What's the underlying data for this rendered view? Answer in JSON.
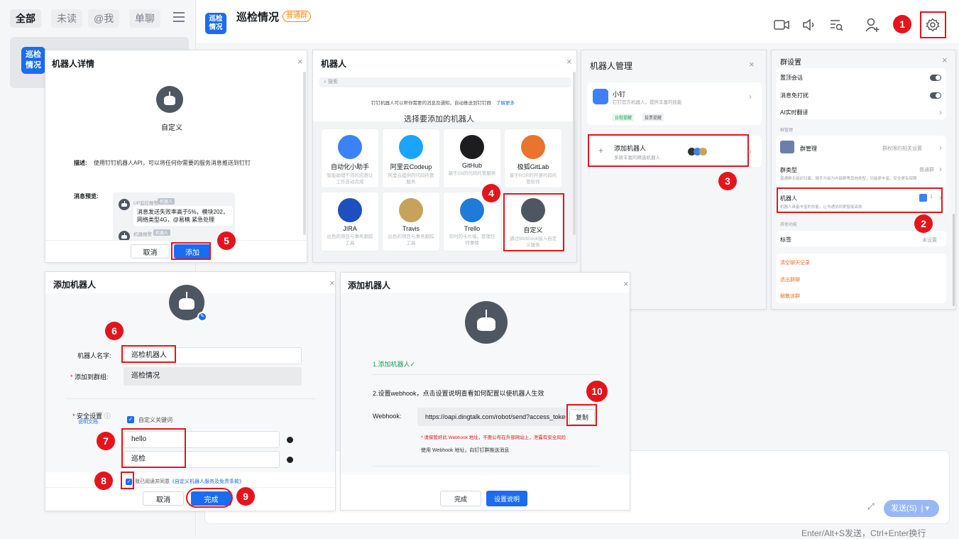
{
  "sidebar": {
    "tabs": [
      "全部",
      "未读",
      "@我",
      "单聊"
    ],
    "menu_icon": "menu-icon",
    "conv_avatar": "巡检\n情况",
    "conv_title": "巡检情况"
  },
  "header": {
    "avatar": "巡检\n情况",
    "title": "巡检情况",
    "badge": "普通群",
    "icons": [
      "video-icon",
      "voice-icon",
      "search-chat-icon",
      "add-member-icon",
      "settings-icon"
    ]
  },
  "steps": [
    "1",
    "2",
    "3",
    "4",
    "5",
    "6",
    "7",
    "8",
    "9",
    "10"
  ],
  "detail": {
    "title": "机器人详情",
    "close": "×",
    "name": "自定义",
    "desc_label": "描述:",
    "desc": "使用钉钉机器人API，可以将任何你需要的服务消息推送到钉钉",
    "preview_label": "消息预览:",
    "msg1_name": "UP监控报警",
    "msg1_tag": "机器人",
    "msg1_text": "消息发送失败率高于5%，模块202，网络类型4G，@易楠 紧急处理",
    "msg2_name": "机器报警",
    "msg2_tag": "机器人",
    "cancel": "取消",
    "add": "添加"
  },
  "robots": {
    "title": "机器人",
    "close": "×",
    "search": "搜索",
    "intro": "钉钉机器人可以帮你需要的消息及通知，自动推送到钉钉群",
    "intro_link": "了解更多",
    "choose": "选择要添加的机器人",
    "items": [
      {
        "name": "自动化小助手",
        "desc": "智能助理不同的应用让工作自动完成",
        "color": "#3b82f6"
      },
      {
        "name": "阿里云Codeup",
        "desc": "阿里云提供的代码托管服务",
        "color": "#1aa3ff"
      },
      {
        "name": "GitHub",
        "desc": "基于Git的代码托管服务",
        "color": "#1d1d1f"
      },
      {
        "name": "极狐GitLab",
        "desc": "基于ROR的开源代码托管软件",
        "color": "#e8742e"
      },
      {
        "name": "JIRA",
        "desc": "出色的项目与事务跟踪工具",
        "color": "#1e4fbf"
      },
      {
        "name": "Travis",
        "desc": "出色的项目与事务跟踪工具",
        "color": "#c8a25a"
      },
      {
        "name": "Trello",
        "desc": "实时的卡片墙，管理任何事情",
        "color": "#1f7bd8"
      },
      {
        "name": "自定义",
        "desc": "通过Webhook接入自定义服务",
        "color": "#4d5661"
      }
    ]
  },
  "manage": {
    "title": "机器人管理",
    "close": "×",
    "xiaoding_name": "小钉",
    "xiaoding_desc": "钉钉官方机器人，提供丰富的技能",
    "chip1": "日程提醒",
    "chip2": "投票提醒",
    "add_name": "添加机器人",
    "add_desc": "多款丰富的精选机器人"
  },
  "group": {
    "title": "群设置",
    "close": "×",
    "pin": "置顶会话",
    "mute": "消息免打扰",
    "translate": "AI实时翻译",
    "section_manage": "群管理",
    "manage_label": "群管理",
    "manage_right": "群权限的相关设置",
    "type_label": "群类型",
    "type_right": "普通群",
    "type_desc": "普通群无组织归属。随手升级为内部群等其他类型，功能更丰富、安全更有保障",
    "robot_label": "机器人",
    "robot_count": "1",
    "robot_desc": "机器人具备丰富的技能，让沟通协同更智能高效",
    "section_other": "其他功能",
    "tag_label": "标签",
    "tag_right": "未设置",
    "clear": "清空聊天记录",
    "quit": "退出群聊",
    "dismiss": "解散该群"
  },
  "add": {
    "title": "添加机器人",
    "close": "×",
    "name_label": "机器人名字:",
    "name_value": "巡检机器人",
    "group_label": "添加到群组:",
    "group_value": "巡检情况",
    "security_label": "安全设置",
    "doc_link": "说明文档",
    "keyword_label": "自定义关键词",
    "kw1": "hello",
    "kw2": "巡检",
    "agree_prefix": "我已阅读并同意",
    "agree_link": "《自定义机器人服务及免责条款》",
    "cancel": "取消",
    "done": "完成"
  },
  "webhook": {
    "title": "添加机器人",
    "close": "×",
    "step1": "1.添加机器人✓",
    "step2": "2.设置webhook，点击设置说明查看如何配置以使机器人生效",
    "label": "Webhook:",
    "url": "https://oapi.dingtalk.com/robot/send?access_toker",
    "copy": "复制",
    "warn": "* 请保管好此 Webhook 地址，不要公布在外部网站上，泄露有安全风险",
    "usage": "使用 Webhook 地址，向钉钉群推送消息",
    "done": "完成",
    "help": "设置说明"
  },
  "composer": {
    "send": "发送(S)",
    "hint": "Enter/Alt+S发送，Ctrl+Enter换行"
  },
  "colors": {
    "accent": "#1a6cf0",
    "highlight": "#e5141c",
    "badge": "#ff8a00"
  }
}
